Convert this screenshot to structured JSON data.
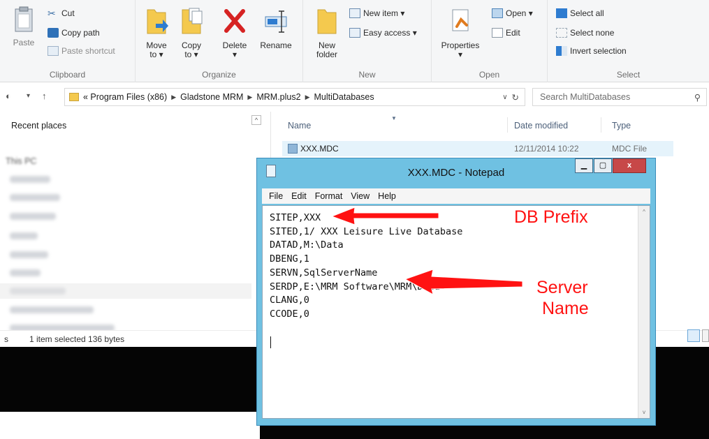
{
  "ribbon": {
    "clipboard": {
      "label": "Clipboard",
      "paste": "Paste",
      "cut": "Cut",
      "copy_path": "Copy path",
      "paste_shortcut": "Paste shortcut"
    },
    "organize": {
      "label": "Organize",
      "move_to": "Move to ▾",
      "copy_to": "Copy to ▾",
      "delete": "Delete",
      "rename": "Rename"
    },
    "new": {
      "label": "New",
      "new_folder": "New folder",
      "new_item": "New item ▾",
      "easy_access": "Easy access ▾"
    },
    "open": {
      "label": "Open",
      "properties": "Properties",
      "open": "Open ▾",
      "edit": "Edit"
    },
    "select": {
      "label": "Select",
      "select_all": "Select all",
      "select_none": "Select none",
      "invert_selection": "Invert selection"
    }
  },
  "address": {
    "segments": [
      "« Program Files (x86)",
      "Gladstone MRM",
      "MRM.plus2",
      "MultiDatabases"
    ],
    "search_placeholder": "Search MultiDatabases"
  },
  "nav": {
    "recent_places": "Recent places",
    "this_pc": "This PC"
  },
  "filelist": {
    "headers": {
      "name": "Name",
      "date": "Date modified",
      "type": "Type"
    },
    "rows": [
      {
        "name": "XXX.MDC",
        "date": "12/11/2014 10:22",
        "type": "MDC File"
      }
    ]
  },
  "status": {
    "count": "s",
    "selection": "1 item selected  136 bytes"
  },
  "notepad": {
    "title": "XXX.MDC - Notepad",
    "menu": [
      "File",
      "Edit",
      "Format",
      "View",
      "Help"
    ],
    "content": "SITEP,XXX\nSITED,1/ XXX Leisure Live Database\nDATAD,M:\\Data\nDBENG,1\nSERVN,SqlServerName\nSERDP,E:\\MRM Software\\MRM\\Data\nCLANG,0\nCCODE,0"
  },
  "annotations": {
    "db_prefix": "DB Prefix",
    "server_name_line1": "Server",
    "server_name_line2": "Name",
    "color": "#ff1212"
  }
}
